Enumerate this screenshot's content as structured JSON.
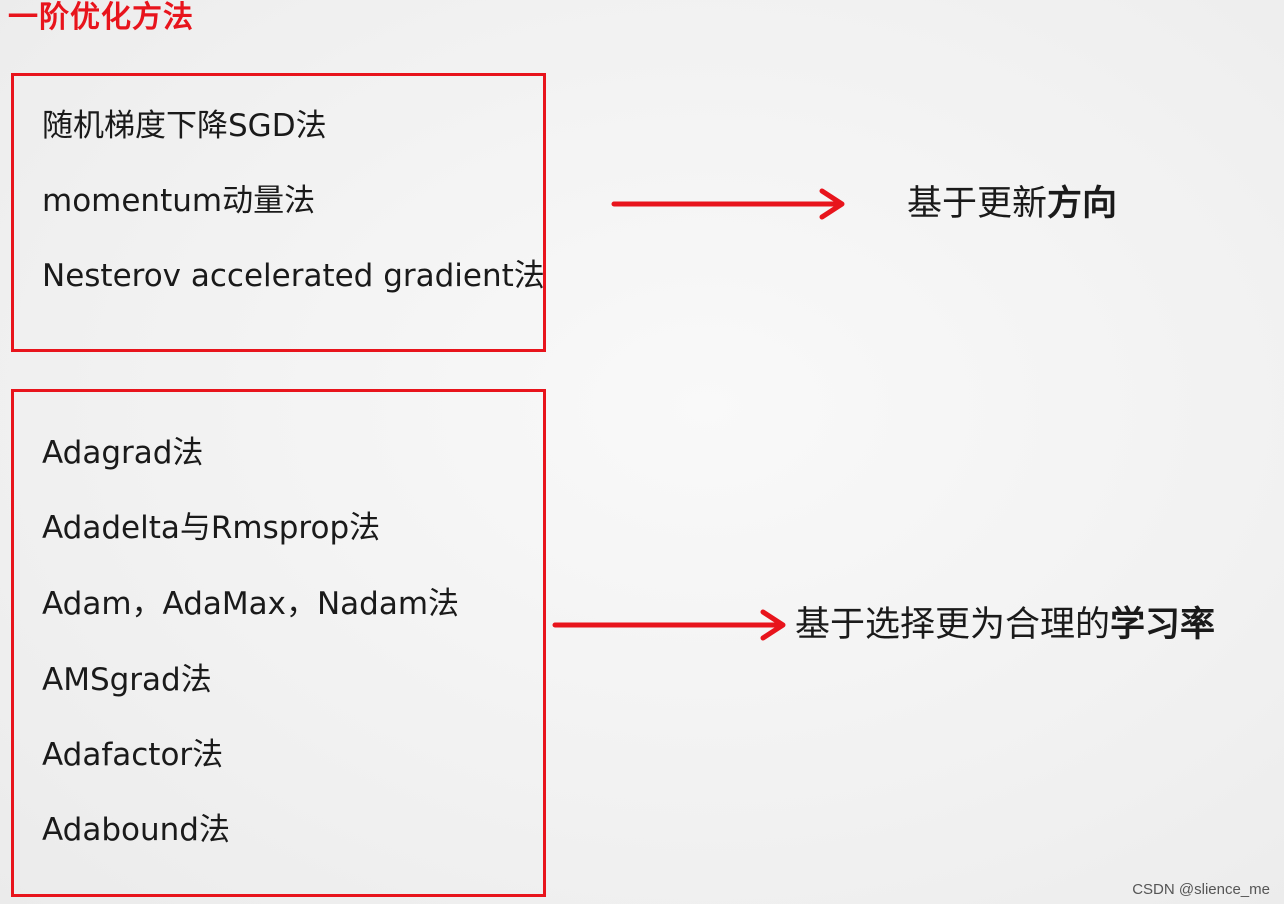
{
  "title": "一阶优化方法",
  "group_direction": {
    "items": [
      "随机梯度下降SGD法",
      "momentum动量法",
      "Nesterov accelerated gradient法"
    ],
    "label_plain": "基于更新",
    "label_bold": "方向"
  },
  "group_learning_rate": {
    "items": [
      "Adagrad法",
      "Adadelta与Rmsprop法",
      "Adam，AdaMax，Nadam法",
      "AMSgrad法",
      "Adafactor法",
      "Adabound法"
    ],
    "label_plain": "基于选择更为合理的",
    "label_bold": "学习率"
  },
  "watermark": "CSDN @slience_me",
  "colors": {
    "accent": "#e8141c",
    "text": "#1a1a1a",
    "background": "#f2f2f2"
  }
}
